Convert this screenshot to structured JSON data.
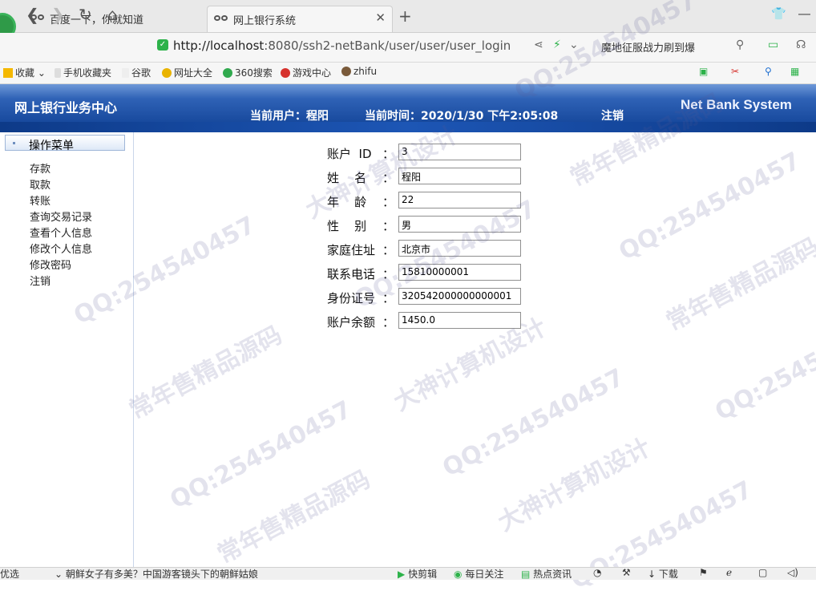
{
  "browser": {
    "tabs": [
      {
        "title": "百度一下，你就知道"
      },
      {
        "title": "网上银行系统",
        "active": true
      }
    ],
    "url_host": "http://localhost",
    "url_path": ":8080/ssh2-netBank/user/user/user_login",
    "hot_search": "魔地征服战力刷到爆",
    "bookmarks": [
      "收藏",
      "手机收藏夹",
      "谷歌",
      "网址大全",
      "360搜索",
      "游戏中心",
      "zhifu"
    ]
  },
  "header": {
    "brand": "网上银行业务中心",
    "current_user": "当前用户：程阳",
    "current_time": "当前时间：2020/1/30 下午2:05:08",
    "logout": "注销",
    "brand_en": "Net Bank System"
  },
  "sidebar": {
    "title": "操作菜单",
    "items": [
      "存款",
      "取款",
      "转账",
      "查询交易记录",
      "查看个人信息",
      "修改个人信息",
      "修改密码",
      "注销"
    ]
  },
  "profile": {
    "fields": [
      {
        "label": "账户  ID",
        "value": "3"
      },
      {
        "label": "姓    名",
        "value": "程阳"
      },
      {
        "label": "年    龄",
        "value": "22"
      },
      {
        "label": "性    别",
        "value": "男"
      },
      {
        "label": "家庭住址",
        "value": "北京市"
      },
      {
        "label": "联系电话",
        "value": "15810000001"
      },
      {
        "label": "身份证号",
        "value": "320542000000000001"
      },
      {
        "label": "账户余额",
        "value": "1450.0"
      }
    ],
    "colon": "："
  },
  "statusbar": {
    "left_items": [
      "优选",
      "朝鲜女子有多美？中国游客镜头下的朝鲜姑娘"
    ],
    "right_items": [
      "快剪辑",
      "每日关注",
      "热点资讯",
      "下载"
    ]
  },
  "watermark": {
    "qq": "QQ:254540457",
    "text1": "常年售精品源码",
    "text2": "大神计算机设计"
  },
  "colors": {
    "banner": "#0e3f93",
    "link_accent": "#2db24a"
  }
}
